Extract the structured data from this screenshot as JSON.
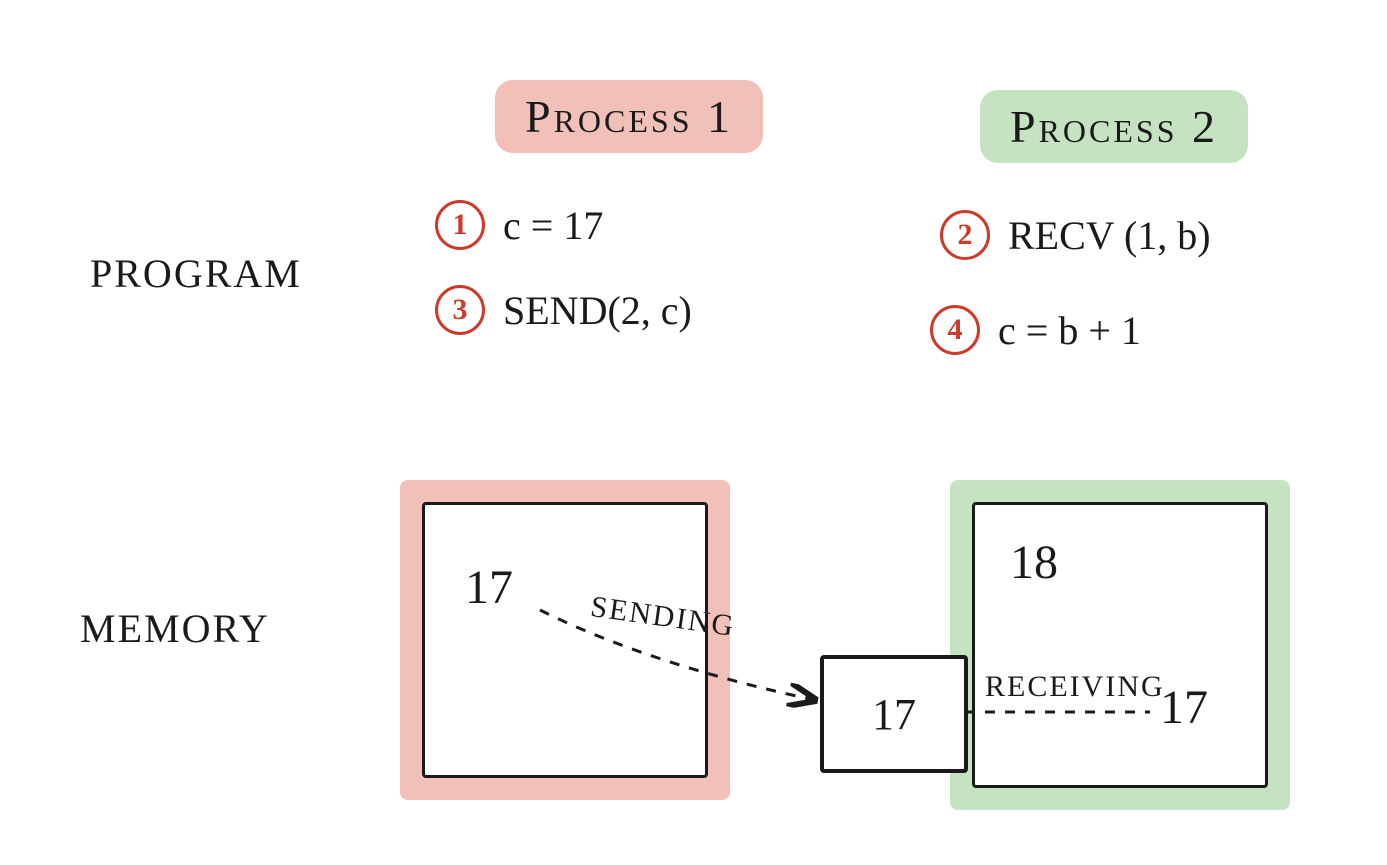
{
  "labels": {
    "program": "PROGRAM",
    "memory": "MEMORY"
  },
  "processes": {
    "p1": {
      "title": "Process 1",
      "steps": [
        {
          "n": "1",
          "code": "c = 17"
        },
        {
          "n": "3",
          "code": "SEND(2, c)"
        }
      ]
    },
    "p2": {
      "title": "Process 2",
      "steps": [
        {
          "n": "2",
          "code": "RECV (1, b)"
        },
        {
          "n": "4",
          "code": "c = b + 1"
        }
      ]
    }
  },
  "memory": {
    "p1_value": "17",
    "message_value": "17",
    "p2_received": "17",
    "p2_result": "18",
    "sending_label": "SENDING",
    "receiving_label": "RECEIVING"
  }
}
